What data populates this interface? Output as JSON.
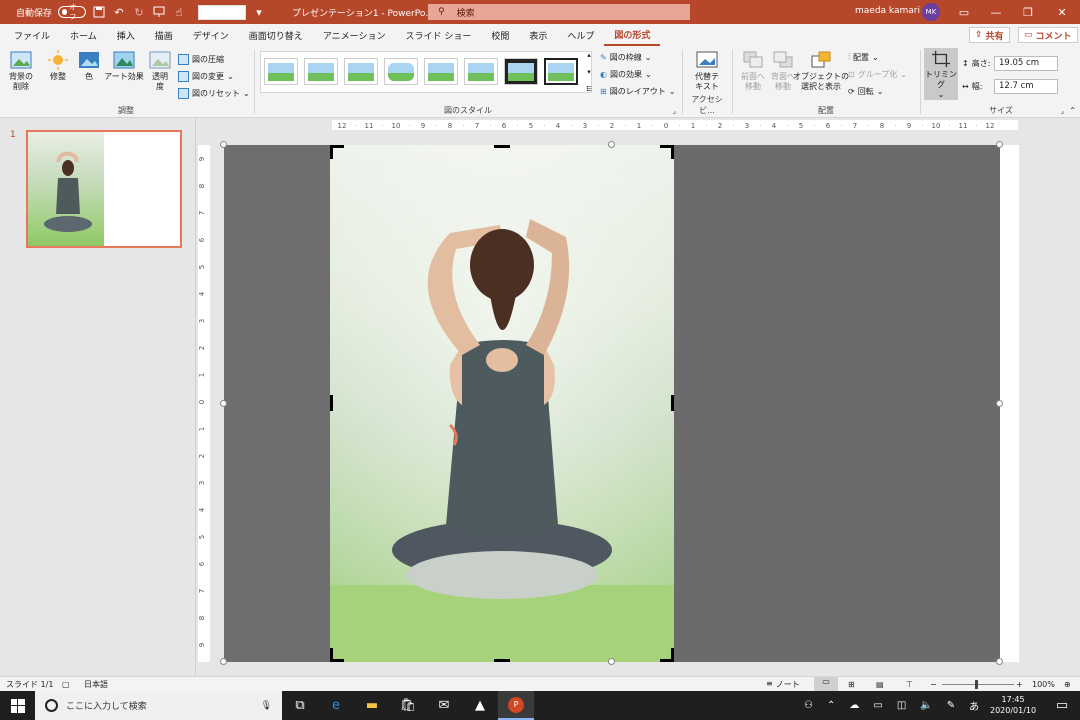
{
  "titlebar": {
    "autosave_label": "自動保存",
    "autosave_state": "オフ",
    "doc_title": "プレゼンテーション1 - PowerPo…",
    "search_placeholder": "検索",
    "user_name": "maeda kamari",
    "user_initials": "MK",
    "icons": [
      "save-icon",
      "undo-icon",
      "redo-icon",
      "present-icon",
      "touch-mode-icon",
      "customize-icon"
    ]
  },
  "menu": {
    "tabs": [
      "ファイル",
      "ホーム",
      "挿入",
      "描画",
      "デザイン",
      "画面切り替え",
      "アニメーション",
      "スライド ショー",
      "校閲",
      "表示",
      "ヘルプ",
      "図の形式"
    ],
    "active_tab": "図の形式",
    "share_label": "共有",
    "comment_label": "コメント"
  },
  "ribbon": {
    "adjust": {
      "remove_bg": "背景の\n削除",
      "correct": "修整",
      "color": "色",
      "art_effects": "アート効果",
      "transparency": "透明\n度",
      "compress": "図の圧縮",
      "change": "図の変更",
      "reset": "図のリセット",
      "group_label": "調整"
    },
    "styles": {
      "border": "図の枠線",
      "effects": "図の効果",
      "layout": "図のレイアウト",
      "group_label": "図のスタイル"
    },
    "accessibility": {
      "alt_text": "代替テ\nキスト",
      "group_label": "アクセシビ..."
    },
    "arrange": {
      "bring_forward": "前面へ\n移動",
      "send_backward": "背面へ\n移動",
      "selection_pane": "オブジェクトの\n選択と表示",
      "align": "配置",
      "group": "グループ化",
      "rotate": "回転",
      "group_label": "配置"
    },
    "size": {
      "crop": "トリミング",
      "height_label": "高さ:",
      "height_value": "19.05 cm",
      "width_label": "幅:",
      "width_value": "12.7 cm",
      "group_label": "サイズ"
    }
  },
  "thumbnails": {
    "slide_number": "1"
  },
  "rulers": {
    "horizontal": [
      "12",
      "11",
      "10",
      "9",
      "8",
      "7",
      "6",
      "5",
      "4",
      "3",
      "2",
      "1",
      "0",
      "1",
      "2",
      "3",
      "4",
      "5",
      "6",
      "7",
      "8",
      "9",
      "10",
      "11",
      "12"
    ],
    "vertical": [
      "9",
      "8",
      "7",
      "6",
      "5",
      "4",
      "3",
      "2",
      "1",
      "0",
      "1",
      "2",
      "3",
      "4",
      "5",
      "6",
      "7",
      "8",
      "9"
    ]
  },
  "status": {
    "slide_indicator": "スライド 1/1",
    "language": "日本語",
    "notes": "ノート",
    "zoom": "100%"
  },
  "taskbar": {
    "search_placeholder": "ここに入力して検索",
    "time": "17:45",
    "date": "2020/01/10",
    "ime": "あ"
  }
}
